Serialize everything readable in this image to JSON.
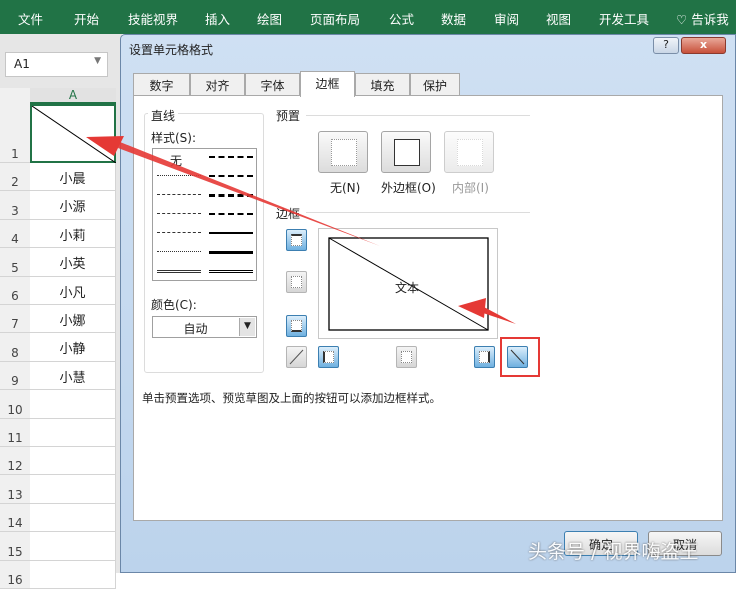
{
  "ribbon": {
    "tabs": [
      "文件",
      "开始",
      "技能视界",
      "插入",
      "绘图",
      "页面布局",
      "公式",
      "数据",
      "审阅",
      "视图",
      "开发工具"
    ],
    "tell_me": "告诉我"
  },
  "sheet": {
    "name_box": "A1",
    "column": "A",
    "rows": [
      "1",
      "2",
      "3",
      "4",
      "5",
      "6",
      "7",
      "8",
      "9",
      "10",
      "11",
      "12",
      "13",
      "14",
      "15",
      "16"
    ],
    "cells": [
      "",
      "小晨",
      "小源",
      "小莉",
      "小英",
      "小凡",
      "小娜",
      "小静",
      "小慧"
    ]
  },
  "dialog": {
    "title": "设置单元格格式",
    "help": "?",
    "close": "x",
    "tabs": [
      "数字",
      "对齐",
      "字体",
      "边框",
      "填充",
      "保护"
    ],
    "line_group": "直线",
    "style_label": "样式(S):",
    "style_none": "无",
    "color_label": "颜色(C):",
    "color_value": "自动",
    "preset_group": "预置",
    "presets": [
      "无(N)",
      "外边框(O)",
      "内部(I)"
    ],
    "border_group": "边框",
    "preview_text": "文本",
    "hint": "单击预置选项、预览草图及上面的按钮可以添加边框样式。",
    "ok": "确定",
    "cancel": "取消"
  },
  "watermark": "头条号 / 视界嗨盗王",
  "colors": {
    "ribbon": "#217346",
    "annotation": "#e53935"
  }
}
